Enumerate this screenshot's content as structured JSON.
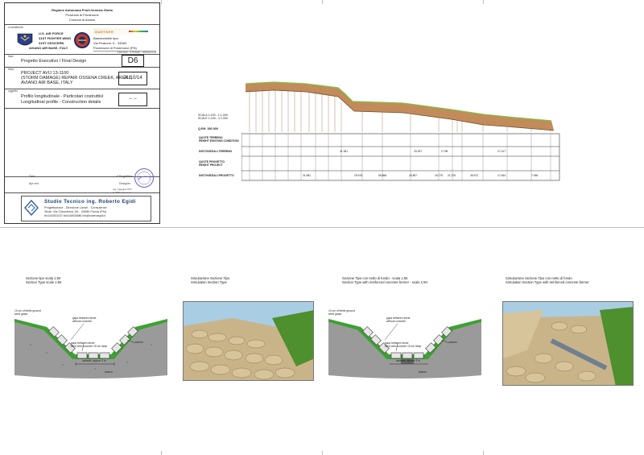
{
  "title_block": {
    "header_lines": [
      "Regione Autonoma Friuli-Venezia Giulia",
      "Provincia di Pordenone",
      "Comune di Aviano"
    ],
    "committente_label": "committente",
    "usaf_lines": [
      "U.S. AIR FORCE",
      "31ST FIGHTER WING",
      "31ST CES/CERN",
      "AVIANO AIR BASE, ITALY"
    ],
    "contractor_name": "GARTNER",
    "contractor_lines": [
      "Bartolomellie tipa",
      "Via Pedrone, 6 - 33083",
      "Pordenone di Pordenone (PN)"
    ],
    "contractor_footer": "EDILIZIA - STRADE - IDRAULICA",
    "fase_label": "fase",
    "phase": "Progetto Esecutivo / Final Design",
    "sheet_code": "D6",
    "titolo_label": "titolo",
    "project_lines": [
      "PROJECT AVIJ 13-1100",
      "(STORM DAMAGE) REPAIR OSSENA CREEK, AREA 1,",
      "AVIANO AIR BASE, ITALY"
    ],
    "date": "21/10/14",
    "oggetto_label": "oggetto",
    "subject_lines": [
      "Profilo longitudinale - Particolari costruttivi",
      "Longitudinal profile - Construction details"
    ],
    "scale": "-- --",
    "data_label": "Data",
    "approved_label": "Apr.ved",
    "engineer_label": "Il Progettista",
    "designer_label": "Designer",
    "stamp_text": "Roberto Egidi",
    "reg_note": "reg. Ingegneri PN\nA. 386 sezione A",
    "studio_name": "Studio Tecnico ing. Roberto Egidi",
    "studio_subtitle": "Progettazione - Direzione Lavori - Consulenze",
    "studio_address": "Sede: Via Colombera 1/b - 33080 Porcia (PN)",
    "studio_contacts": "tel.0434921037   fax0434926880   info@robertoegidi.it"
  },
  "profile": {
    "scale_lines": [
      "SCALA 1:100 - 1:1.000",
      "SCALE 1:100 - 1:1.000"
    ],
    "datum": "Q.Rif. 150.000",
    "row_labels": [
      "QUOTE TERRENO\nHEIGHT EXISTING CONDITION",
      "DIST.PARZIALI TERRENO",
      "QUOTE PROGETTO\nHEIGHT PROJECT",
      "DIST.PARZIALI PROGETTO"
    ],
    "terrain_partial_values": [
      "21.361",
      "33.257",
      "2.796",
      "27.417"
    ],
    "project_partial_values": [
      "31.881",
      "29.578",
      "55.868",
      "16.897",
      "18.775",
      "21.376",
      "36.972",
      "17.644",
      "7.946"
    ]
  },
  "details": [
    {
      "caption_lines": [
        "Sezione tipo scala 1:50",
        "Section Type scale 1:50"
      ],
      "labels": [
        "10 cm of fertile ground",
        "seed grass",
        "gaps between stone",
        "without concrete",
        "gaps between stone",
        "filled with concrete 15 cm deep",
        "stones",
        "stones",
        "variable, approx 3 m"
      ]
    },
    {
      "caption_lines": [
        "Simulazione Sezione Tipo",
        "Simulation Section Type"
      ]
    },
    {
      "caption_lines": [
        "Sezione Tipo con netto di fondo - scala 1:50",
        "Section Type with reinforced concrete berner - scale 1:50"
      ],
      "labels": [
        "10 cm of fertile ground",
        "seed grass",
        "gaps between stone",
        "without concrete",
        "gaps between stone",
        "filled with concrete 15 cm deep",
        "stones",
        "stones",
        "variable, approx 3 m"
      ]
    },
    {
      "caption_lines": [
        "Simulazione Sezione Tipo con netto di fondo",
        "Simulation Section Type with reinforced concrete berner"
      ]
    }
  ]
}
